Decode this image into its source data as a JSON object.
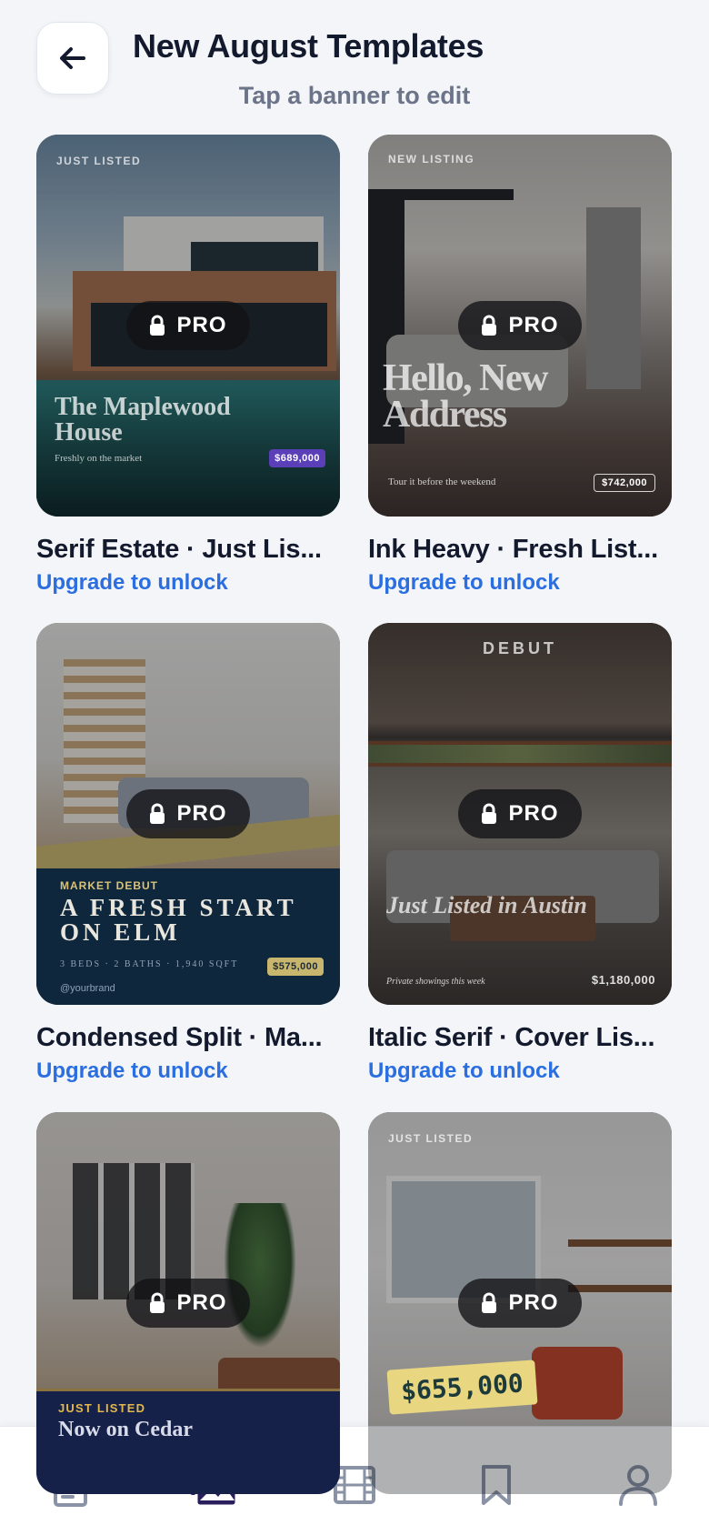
{
  "header": {
    "title": "New August Templates",
    "subtitle": "Tap a banner to edit",
    "back_icon": "arrow-left-icon"
  },
  "pro_label": "PRO",
  "cards": [
    {
      "title": "Serif Estate · Just Lis...",
      "action": "Upgrade to unlock",
      "eyebrow": "JUST LISTED",
      "headline": "The Maplewood House",
      "tagline": "Freshly on the market",
      "price": "$689,000"
    },
    {
      "title": "Ink Heavy · Fresh List...",
      "action": "Upgrade to unlock",
      "eyebrow": "NEW LISTING",
      "headline": "Hello, New Address",
      "tagline": "Tour it before the weekend",
      "price": "$742,000"
    },
    {
      "title": "Condensed Split · Ma...",
      "action": "Upgrade to unlock",
      "eyebrow": "MARKET DEBUT",
      "headline": "A FRESH START ON ELM",
      "specs": "3 BEDS · 2 BATHS · 1,940 SQFT",
      "handle": "@yourbrand",
      "price": "$575,000"
    },
    {
      "title": "Italic Serif · Cover Lis...",
      "action": "Upgrade to unlock",
      "eyebrow": "DEBUT",
      "headline": "Just Listed in Austin",
      "tagline": "Private showings this week",
      "price": "$1,180,000"
    },
    {
      "title": "",
      "eyebrow": "JUST LISTED",
      "headline": "Now on Cedar"
    },
    {
      "title": "",
      "eyebrow": "JUST LISTED",
      "price": "$655,000"
    }
  ],
  "colors": {
    "accent": "#2a6ee0",
    "active_nav": "#2a1f5c",
    "inactive_nav": "#8a92a6",
    "background": "#f3f5f9"
  },
  "nav": {
    "items": [
      {
        "icon": "document-icon",
        "active": false
      },
      {
        "icon": "images-icon",
        "active": true
      },
      {
        "icon": "film-icon",
        "active": false
      },
      {
        "icon": "bookmark-icon",
        "active": false
      },
      {
        "icon": "profile-icon",
        "active": false
      }
    ]
  }
}
